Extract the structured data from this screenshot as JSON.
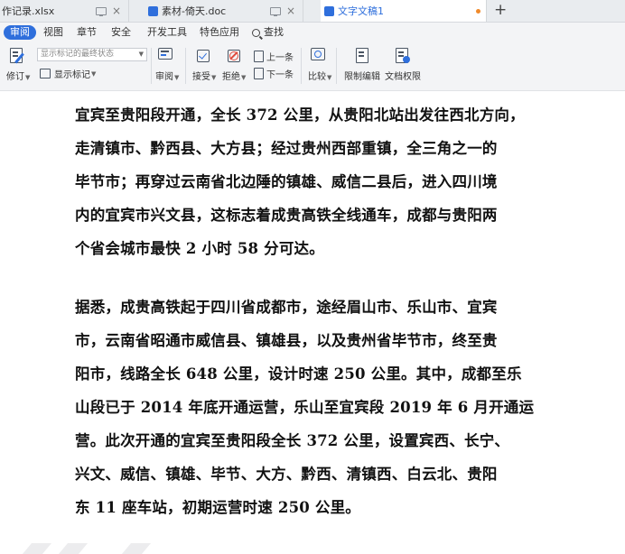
{
  "tabs": [
    {
      "label": "作记录.xlsx",
      "active": false
    },
    {
      "label": "素材-倚天.doc",
      "active": false
    },
    {
      "label": "文字文稿1",
      "active": true
    }
  ],
  "tab_icons": [
    "xlsx-icon",
    "doc-icon",
    "doc-icon"
  ],
  "menu": {
    "items": [
      "审阅",
      "视图",
      "章节",
      "安全",
      "开发工具",
      "特色应用"
    ],
    "search_label": "查找",
    "active_item": "审阅"
  },
  "ribbon": {
    "revise": "修订",
    "markup_select": "显示标记的最终状态",
    "show_markup": "显示标记",
    "review": "审阅",
    "accept": "接受",
    "reject": "拒绝",
    "prev": "上一条",
    "next": "下一条",
    "compare": "比较",
    "restrict": "限制编辑",
    "permissions": "文档权限"
  },
  "document": {
    "para1": [
      "宜宾至贵阳段开通，全长 372 公里，从贵阳北站出发往西北方向，",
      "走清镇市、黔西县、大方县；经过贵州西部重镇，全三角之一的",
      "毕节市；再穿过云南省北边陲的镇雄、威信二县后，进入四川境",
      "内的宜宾市兴文县，这标志着成贵高铁全线通车，成都与贵阳两",
      "个省会城市最快 2 小时 58 分可达。"
    ],
    "para2": [
      "据悉，成贵高铁起于四川省成都市，途经眉山市、乐山市、宜宾",
      "市，云南省昭通市威信县、镇雄县，以及贵州省毕节市，终至贵",
      "阳市，线路全长 648 公里，设计时速 250 公里。其中，成都至乐",
      "山段已于 2014 年底开通运营，乐山至宜宾段 2019 年 6 月开通运",
      "营。此次开通的宜宾至贵阳段全长 372 公里，设置宾西、长宁、",
      "兴文、威信、镇雄、毕节、大方、黔西、清镇西、白云北、贵阳",
      "东 11 座车站，初期运营时速 250 公里。"
    ]
  },
  "colors": {
    "accent": "#2f6fdc",
    "tab_bar": "#e9ecef",
    "ribbon_bg": "#f3f4f6",
    "unsaved_dot": "#f08a2b"
  }
}
